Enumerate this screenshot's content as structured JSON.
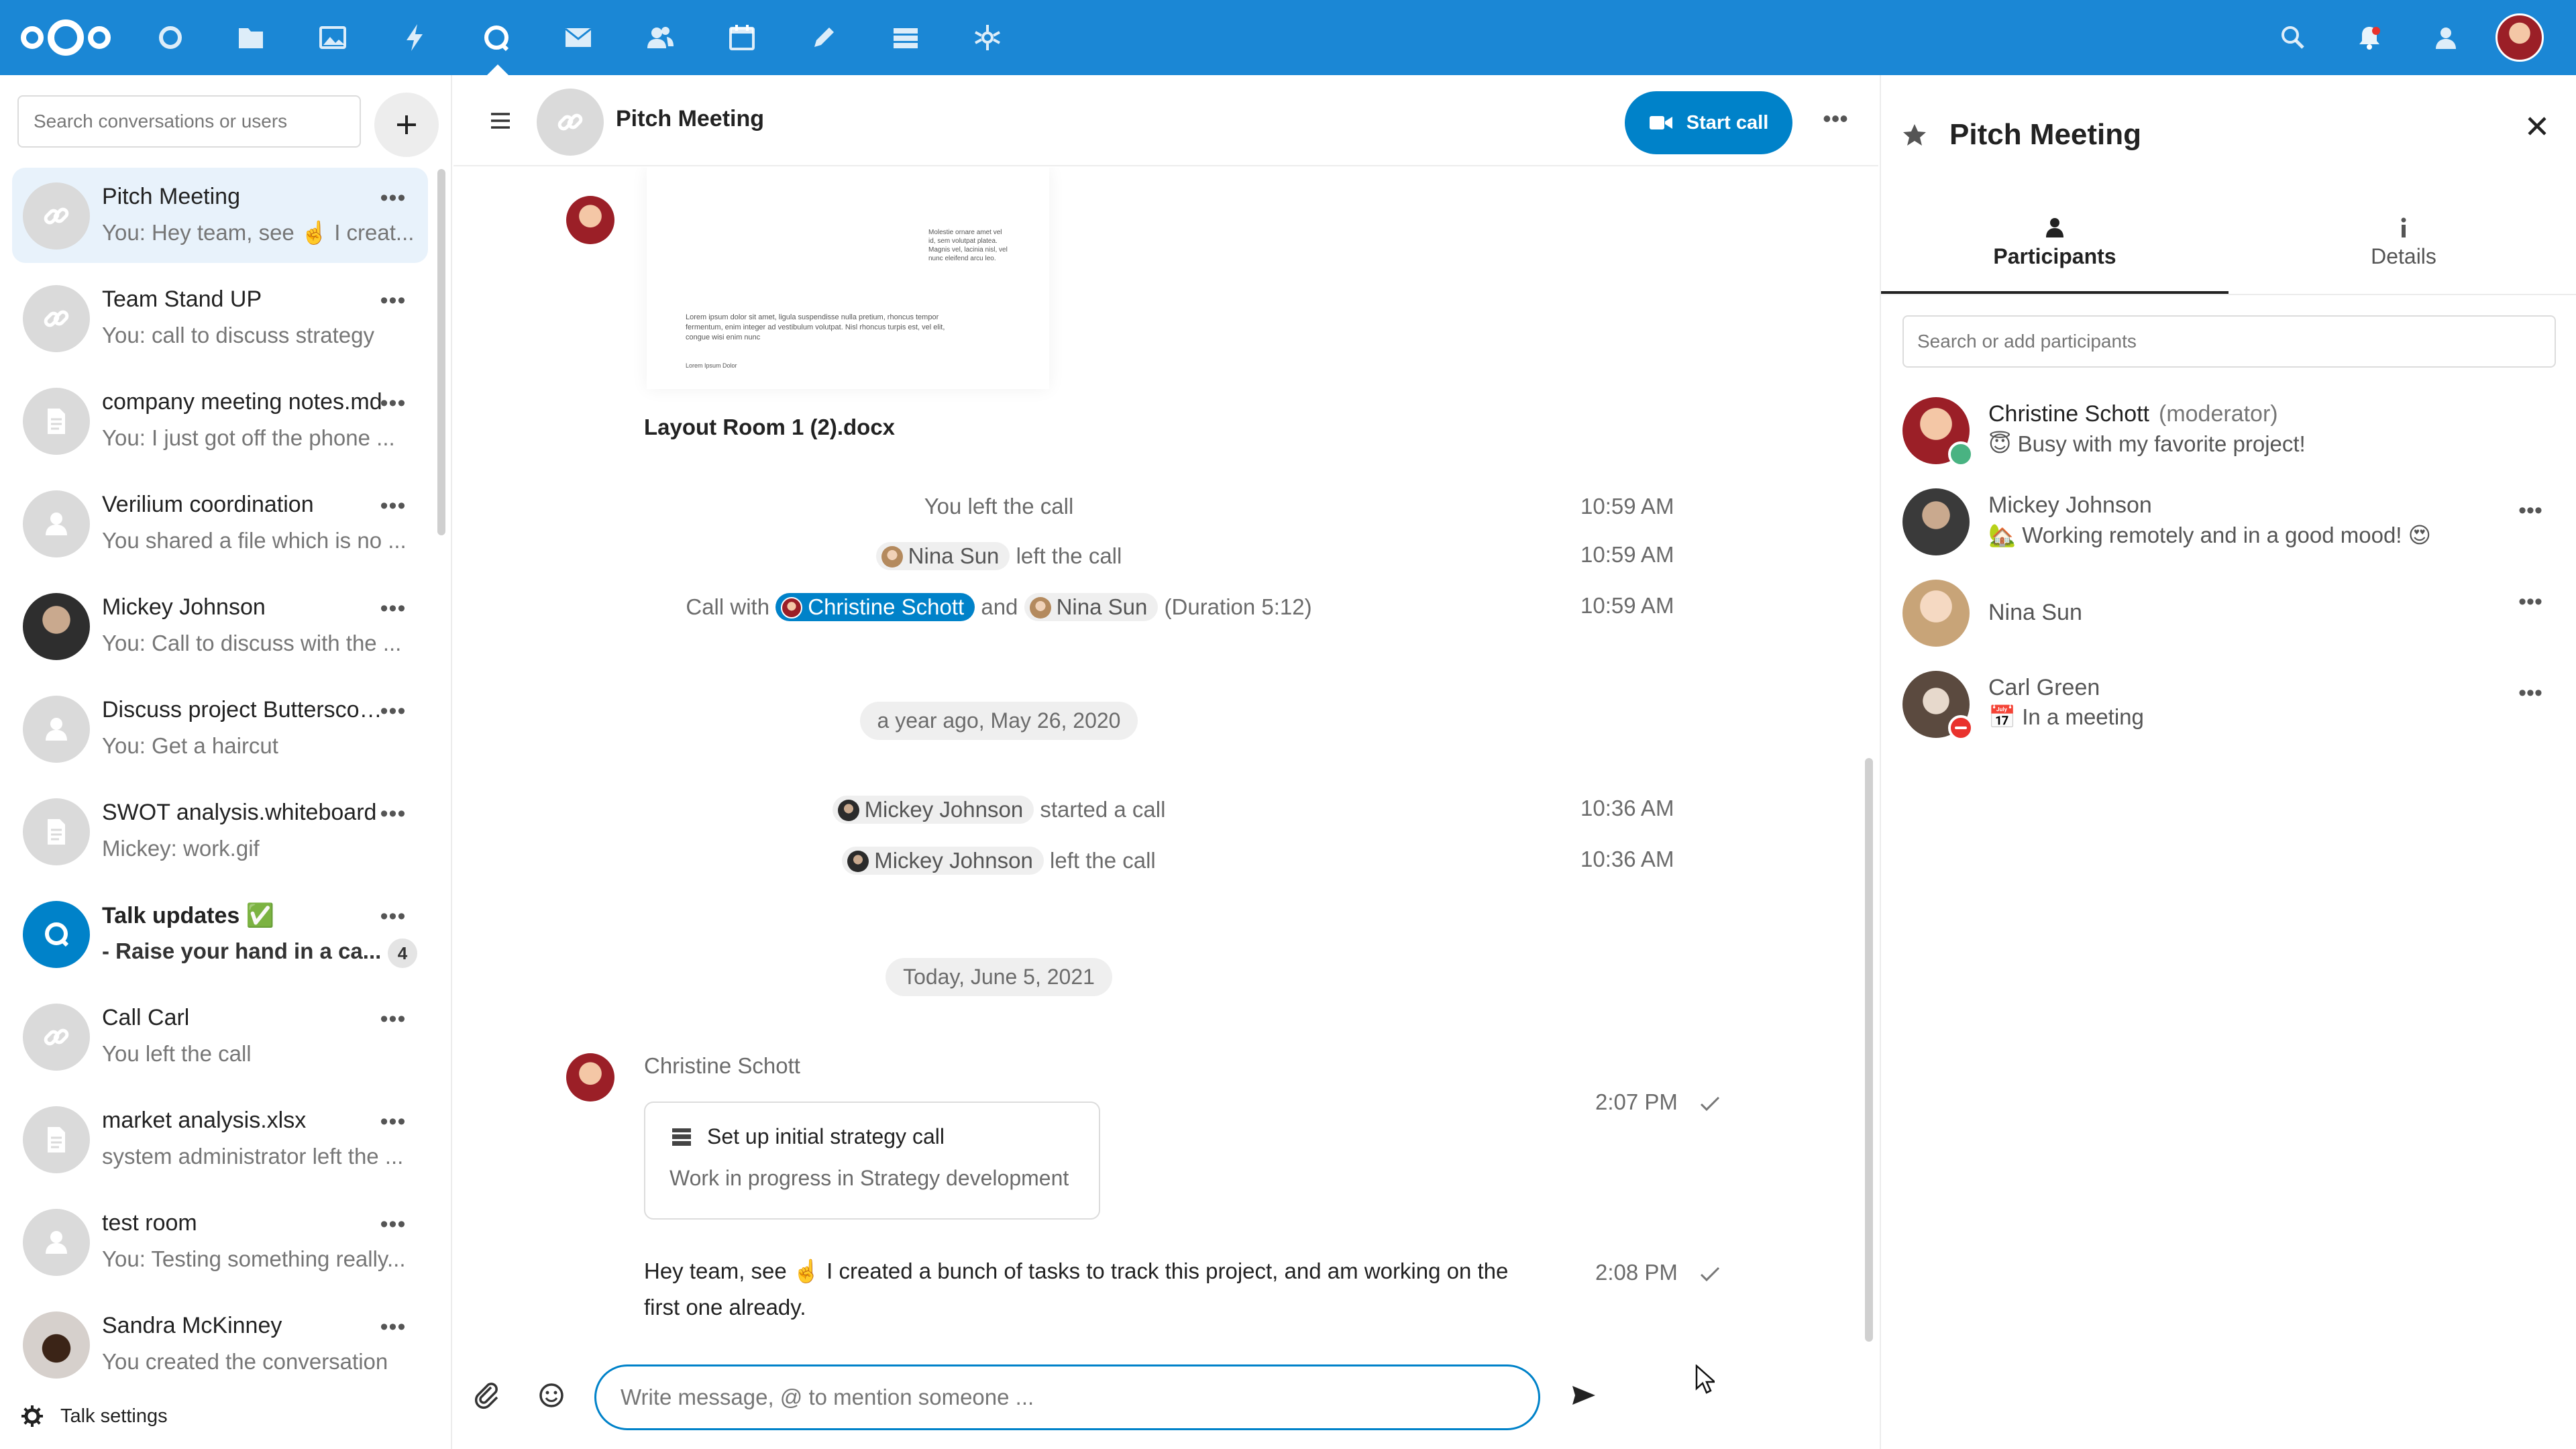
{
  "topbar": {
    "logo": "nextcloud-logo",
    "apps": [
      "dashboard-icon",
      "files-icon",
      "photos-icon",
      "activity-icon",
      "talk-icon",
      "mail-icon",
      "contacts-icon",
      "calendar-icon",
      "notes-icon",
      "deck-icon",
      "federation-icon"
    ],
    "right_icons": [
      "search-icon",
      "notifications-icon",
      "contacts-menu-icon",
      "user-avatar"
    ],
    "accent": "#1b87d5"
  },
  "sidebar": {
    "search_placeholder": "Search conversations or users",
    "conversations": [
      {
        "name": "Pitch Meeting",
        "last": "You: Hey team, see ☝️ I creat...",
        "avatar": "link",
        "active": true
      },
      {
        "name": "Team Stand UP",
        "last": "You: call to discuss strategy",
        "avatar": "link"
      },
      {
        "name": "company meeting notes.md",
        "last": "You: I just got off the phone ...",
        "avatar": "file"
      },
      {
        "name": "Verilium coordination",
        "last": "You shared a file which is no ...",
        "avatar": "user"
      },
      {
        "name": "Mickey Johnson",
        "last": "You: Call to discuss with the ...",
        "avatar": "photo-dark"
      },
      {
        "name": "Discuss project Butterscotch",
        "last": "You: Get a haircut",
        "avatar": "user"
      },
      {
        "name": "SWOT analysis.whiteboard",
        "last": "Mickey: work.gif",
        "avatar": "file"
      },
      {
        "name": "Talk updates ✅",
        "last": "- Raise your hand in a ca...",
        "avatar": "talk",
        "unread": "4",
        "bold": true
      },
      {
        "name": "Call Carl",
        "last": "You left the call",
        "avatar": "link"
      },
      {
        "name": "market analysis.xlsx",
        "last": "system administrator left the ...",
        "avatar": "file"
      },
      {
        "name": "test room",
        "last": "You: Testing something really...",
        "avatar": "user"
      },
      {
        "name": "Sandra McKinney",
        "last": "You created the conversation",
        "avatar": "photo-coffee"
      }
    ],
    "more_label": "•••",
    "settings_label": "Talk settings"
  },
  "chat": {
    "title": "Pitch Meeting",
    "start_call_label": "Start call",
    "more_label": "•••",
    "file": {
      "name": "Layout Room 1 (2).docx",
      "preview_col": "Molestie ornare amet vel id, sem volutpat platea. Magnis vel, lacinia nisl, vel nunc eleifend arcu leo.",
      "preview_body": "Lorem ipsum dolor sit amet, ligula suspendisse nulla pretium, rhoncus tempor fermentum, enim integer ad vestibulum volutpat. Nisl rhoncus turpis est, vel elit, congue wisi enim nunc",
      "preview_footer": "Lorem Ipsum Dolor"
    },
    "sys1": {
      "text": "You left the call",
      "time": "10:59 AM"
    },
    "sys2": {
      "user": "Nina Sun",
      "text": "left the call",
      "time": "10:59 AM"
    },
    "sys3": {
      "prefix": "Call with",
      "user1": "Christine Schott",
      "and": "and",
      "user2": "Nina Sun",
      "suffix": "(Duration 5:12)",
      "time": "10:59 AM"
    },
    "date1": "a year ago, May 26, 2020",
    "sys4": {
      "user": "Mickey Johnson",
      "text": "started a call",
      "time": "10:36 AM"
    },
    "sys5": {
      "user": "Mickey Johnson",
      "text": "left the call",
      "time": "10:36 AM"
    },
    "date2": "Today, June 5, 2021",
    "author": "Christine Schott",
    "deck_card": {
      "title": "Set up initial strategy call",
      "desc": "Work in progress in Strategy development",
      "time": "2:07 PM"
    },
    "message": {
      "text": "Hey team, see ☝️ I created a bunch of tasks to track this project, and am working on the first one already.",
      "time": "2:08 PM"
    },
    "composer_placeholder": "Write message, @ to mention someone ..."
  },
  "right": {
    "title": "Pitch Meeting",
    "tabs": [
      {
        "label": "Participants",
        "active": true
      },
      {
        "label": "Details"
      }
    ],
    "search_placeholder": "Search or add participants",
    "participants": [
      {
        "name": "Christine Schott",
        "role": "(moderator)",
        "status": "😇 Busy with my favorite project!",
        "presence": "online"
      },
      {
        "name": "Mickey Johnson",
        "status": "🏡 Working remotely and in a good mood! 😍"
      },
      {
        "name": "Nina Sun",
        "status": ""
      },
      {
        "name": "Carl Green",
        "status": "📅 In a meeting",
        "presence": "dnd"
      }
    ],
    "more_label": "•••"
  }
}
